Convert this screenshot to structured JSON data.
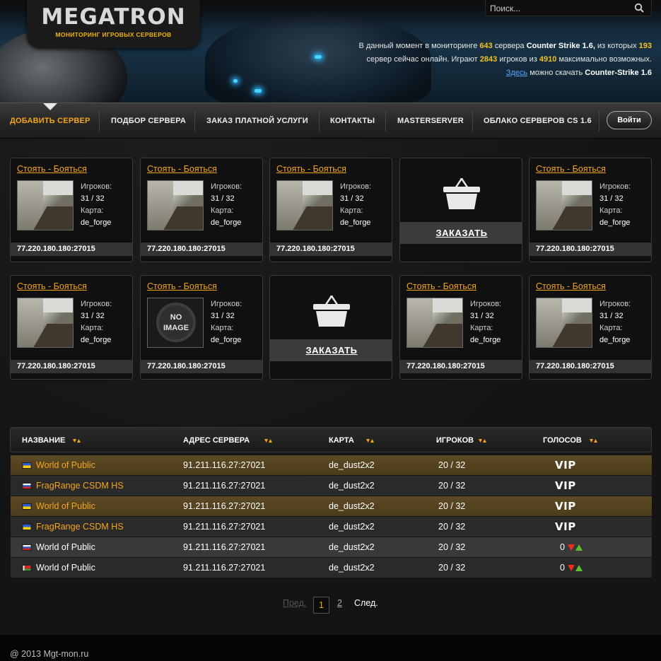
{
  "header": {
    "logo_title": "MEGATRON",
    "logo_subtitle": "МОНИТОРИНГ ИГРОВЫХ СЕРВЕРОВ",
    "search_placeholder": "Поиск...",
    "stats": {
      "line1_pre": "В данный момент в мониторинге",
      "servers_total": "643",
      "line1_mid": "сервера",
      "game": "Counter Strike 1.6,",
      "line1_post": "из которых",
      "servers_online": "193",
      "line2_pre": "сервер сейчас онлайн. Играют",
      "players_now": "2843",
      "line2_mid": "игроков из",
      "players_max": "4910",
      "line2_post": "максимально возможных.",
      "line3_link": "Здесь",
      "line3_mid": "можно скачать",
      "line3_game": "Counter-Strike 1.6"
    }
  },
  "nav": {
    "items": [
      {
        "label": "ДОБАВИТЬ СЕРВЕР"
      },
      {
        "label": "ПОДБОР СЕРВЕРА"
      },
      {
        "label": "ЗАКАЗ ПЛАТНОЙ УСЛУГИ"
      },
      {
        "label": "КОНТАКТЫ"
      },
      {
        "label": "MASTERSERVER"
      },
      {
        "label": "ОБЛАКО СЕРВЕРОВ CS 1.6"
      }
    ],
    "login_label": "Войти"
  },
  "cards": {
    "title": "Стоять - Бояться",
    "players_label": "Игроков:",
    "players_value": "31 / 32",
    "map_label": "Карта:",
    "map_value": "de_forge",
    "ip": "77.220.180.180:27015",
    "no_image_line1": "NO",
    "no_image_line2": "IMAGE",
    "order_label": "ЗАКАЗАТЬ"
  },
  "table": {
    "headers": [
      "НАЗВАНИЕ",
      "АДРЕС СЕРВЕРА",
      "КАРТА",
      "ИГРОКОВ",
      "ГОЛОСОВ"
    ],
    "rows": [
      {
        "flag": "ua",
        "name": "World of Public",
        "address": "91.211.116.27:27021",
        "map": "de_dust2x2",
        "players": "20 / 32",
        "votes": "VIP",
        "style": "vip"
      },
      {
        "flag": "ru",
        "name": "FragRange CSDM HS",
        "address": "91.211.116.27:27021",
        "map": "de_dust2x2",
        "players": "20 / 32",
        "votes": "VIP",
        "style": "dark"
      },
      {
        "flag": "ua",
        "name": "World of Public",
        "address": "91.211.116.27:27021",
        "map": "de_dust2x2",
        "players": "20 / 32",
        "votes": "VIP",
        "style": "vip"
      },
      {
        "flag": "ua",
        "name": "FragRange CSDM HS",
        "address": "91.211.116.27:27021",
        "map": "de_dust2x2",
        "players": "20 / 32",
        "votes": "VIP",
        "style": "dark"
      },
      {
        "flag": "ru",
        "name": "World of Public",
        "address": "91.211.116.27:27021",
        "map": "de_dust2x2",
        "players": "20 / 32",
        "votes": "0",
        "style": "gray"
      },
      {
        "flag": "by",
        "name": "World of Public",
        "address": "91.211.116.27:27021",
        "map": "de_dust2x2",
        "players": "20 / 32",
        "votes": "0",
        "style": "plain"
      }
    ]
  },
  "pagination": {
    "prev": "Пред.",
    "pages": [
      "1",
      "2"
    ],
    "next": "След."
  },
  "footer": {
    "text": "@ 2013  Mgt-mon.ru"
  },
  "colors": {
    "accent": "#f3a51c",
    "vip_row": "#5a4621",
    "highlight_number": "#f3c21c"
  }
}
